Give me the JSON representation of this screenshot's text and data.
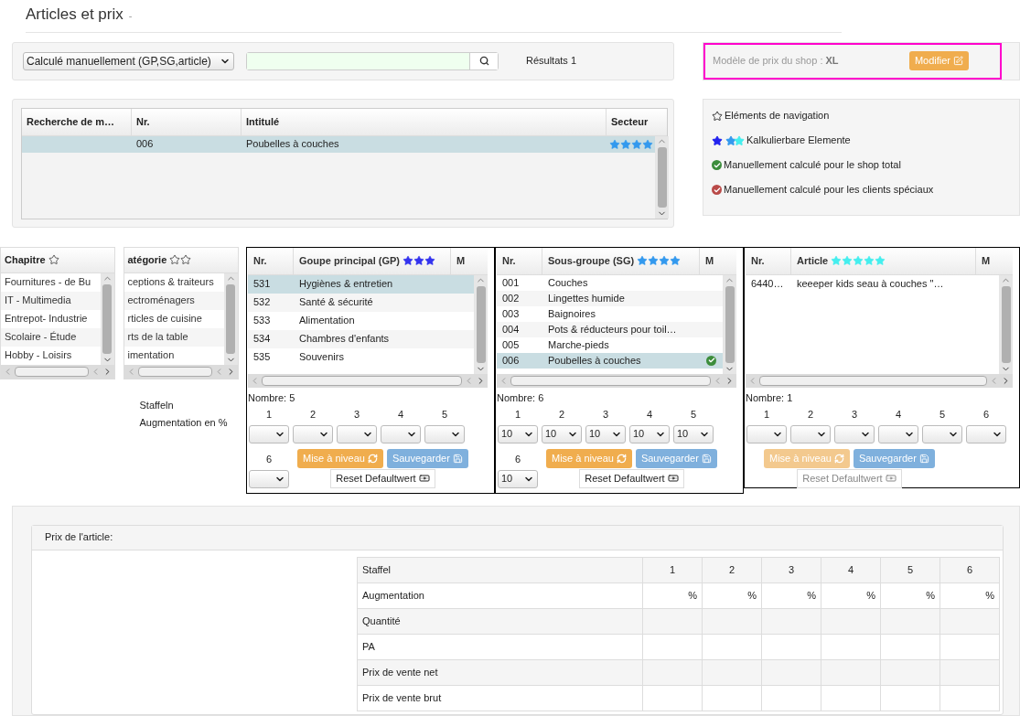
{
  "page": {
    "title": "Articles et prix",
    "title_suffix": "-"
  },
  "filter": {
    "mode": "Calculé manuellement (GP,SG,article)",
    "results": "Résultats 1"
  },
  "shop_model": {
    "label": "Modèle de prix du shop :",
    "value": "XL",
    "button": "Modifier",
    "highlighted": true
  },
  "search_table": {
    "columns": [
      "Recherche de m…",
      "Nr.",
      "Intitulé",
      "Secteur"
    ],
    "rows": [
      {
        "nr": "006",
        "title": "Poubelles à couches",
        "stars": 4,
        "selected": true
      }
    ]
  },
  "legend": [
    {
      "kind": "outline_star",
      "text": "Eléments de navigation"
    },
    {
      "kind": "star_trio",
      "text": "Kalkulierbare Elemente"
    },
    {
      "kind": "check",
      "color": "#3c8d3c",
      "text": "Manuellement calculé pour le shop total"
    },
    {
      "kind": "check",
      "color": "#b94a48",
      "text": "Manuellement calculé pour les clients spéciaux"
    }
  ],
  "lists": [
    {
      "title": "Chapitre",
      "kind": "chapter",
      "items": [
        {
          "label": "Fournitures - de Bu",
          "selected": false
        },
        {
          "label": "IT - Multimedia",
          "selected": false
        },
        {
          "label": "Entrepot- Industrie",
          "selected": false
        },
        {
          "label": "Scolaire - Étude",
          "selected": false
        },
        {
          "label": "Hobby - Loisirs",
          "selected": false
        }
      ]
    },
    {
      "title": "atégorie",
      "kind": "category",
      "items": [
        {
          "label": "ceptions & traiteurs",
          "selected": false
        },
        {
          "label": "ectroménagers",
          "selected": false
        },
        {
          "label": "rticles de cuisine",
          "selected": false
        },
        {
          "label": "rts de la table",
          "selected": false
        },
        {
          "label": "imentation",
          "selected": false
        }
      ]
    }
  ],
  "staffeln_label": "Staffeln",
  "augmentation_label": "Augmentation en %",
  "groups": [
    {
      "columns": [
        "Nr.",
        "Goupe principal (GP)",
        "M"
      ],
      "stars": 3,
      "color": "#3333ee",
      "rows": [
        {
          "nr": "531",
          "name": "Hygiènes & entretien",
          "selected": true,
          "manual": false
        },
        {
          "nr": "532",
          "name": "Santé & sécurité",
          "selected": false,
          "manual": false
        },
        {
          "nr": "533",
          "name": "Alimentation",
          "selected": false,
          "manual": false
        },
        {
          "nr": "534",
          "name": "Chambres d'enfants",
          "selected": false,
          "manual": false
        },
        {
          "nr": "535",
          "name": "Souvenirs",
          "selected": false,
          "manual": false
        }
      ],
      "count": "Nombre: 5",
      "staffeln": [
        {
          "label": "1"
        },
        {
          "label": "2"
        },
        {
          "label": "3"
        },
        {
          "label": "4"
        },
        {
          "label": "5"
        },
        {
          "label": "6"
        }
      ],
      "level_button": {
        "label": "Mise à niveau",
        "disabled": false
      },
      "save_button": "Sauvegarder",
      "reset_button": {
        "label": "Reset Defaultwert",
        "disabled": false
      }
    },
    {
      "columns": [
        "Nr.",
        "Sous-groupe (SG)",
        "M"
      ],
      "stars": 4,
      "color": "#3399ee",
      "rows": [
        {
          "nr": "001",
          "name": "Couches",
          "selected": false,
          "manual": false
        },
        {
          "nr": "002",
          "name": "Lingettes humide",
          "selected": false,
          "manual": false
        },
        {
          "nr": "003",
          "name": "Baignoires",
          "selected": false,
          "manual": false
        },
        {
          "nr": "004",
          "name": "Pots & réducteurs pour toil…",
          "selected": false,
          "manual": false
        },
        {
          "nr": "005",
          "name": "Marche-pieds",
          "selected": false,
          "manual": false
        },
        {
          "nr": "006",
          "name": "Poubelles à couches",
          "selected": true,
          "manual": true
        }
      ],
      "count": "Nombre: 6",
      "staffeln": [
        {
          "label": "1",
          "value": "10"
        },
        {
          "label": "2",
          "value": "10"
        },
        {
          "label": "3",
          "value": "10"
        },
        {
          "label": "4",
          "value": "10"
        },
        {
          "label": "5",
          "value": "10"
        },
        {
          "label": "6",
          "value": "10"
        }
      ],
      "level_button": {
        "label": "Mise à niveau",
        "disabled": false
      },
      "save_button": "Sauvegarder",
      "reset_button": {
        "label": "Reset Defaultwert",
        "disabled": false
      }
    },
    {
      "columns": [
        "Nr.",
        "Article",
        "M"
      ],
      "stars": 5,
      "color": "#44eeee",
      "rows": [
        {
          "nr": "6440…",
          "name": "keeeper kids seau à couches \"…",
          "selected": false,
          "manual": false
        }
      ],
      "count": "Nombre: 1",
      "staffeln": [
        {
          "label": "1"
        },
        {
          "label": "2"
        },
        {
          "label": "3"
        },
        {
          "label": "4"
        },
        {
          "label": "5"
        },
        {
          "label": "6"
        }
      ],
      "level_button": {
        "label": "Mise à niveau",
        "disabled": true
      },
      "save_button": "Sauvegarder",
      "reset_button": {
        "label": "Reset Defaultwert",
        "disabled": true
      }
    }
  ],
  "price": {
    "title": "Prix de l'article:",
    "header": [
      "Staffel",
      "1",
      "2",
      "3",
      "4",
      "5",
      "6"
    ],
    "rows": [
      {
        "label": "Augmentation",
        "cells": [
          "%",
          "%",
          "%",
          "%",
          "%",
          "%"
        ]
      },
      {
        "label": "Quantité"
      },
      {
        "label": "PA"
      },
      {
        "label": "Prix de vente net"
      },
      {
        "label": "Prix de vente brut"
      }
    ]
  }
}
